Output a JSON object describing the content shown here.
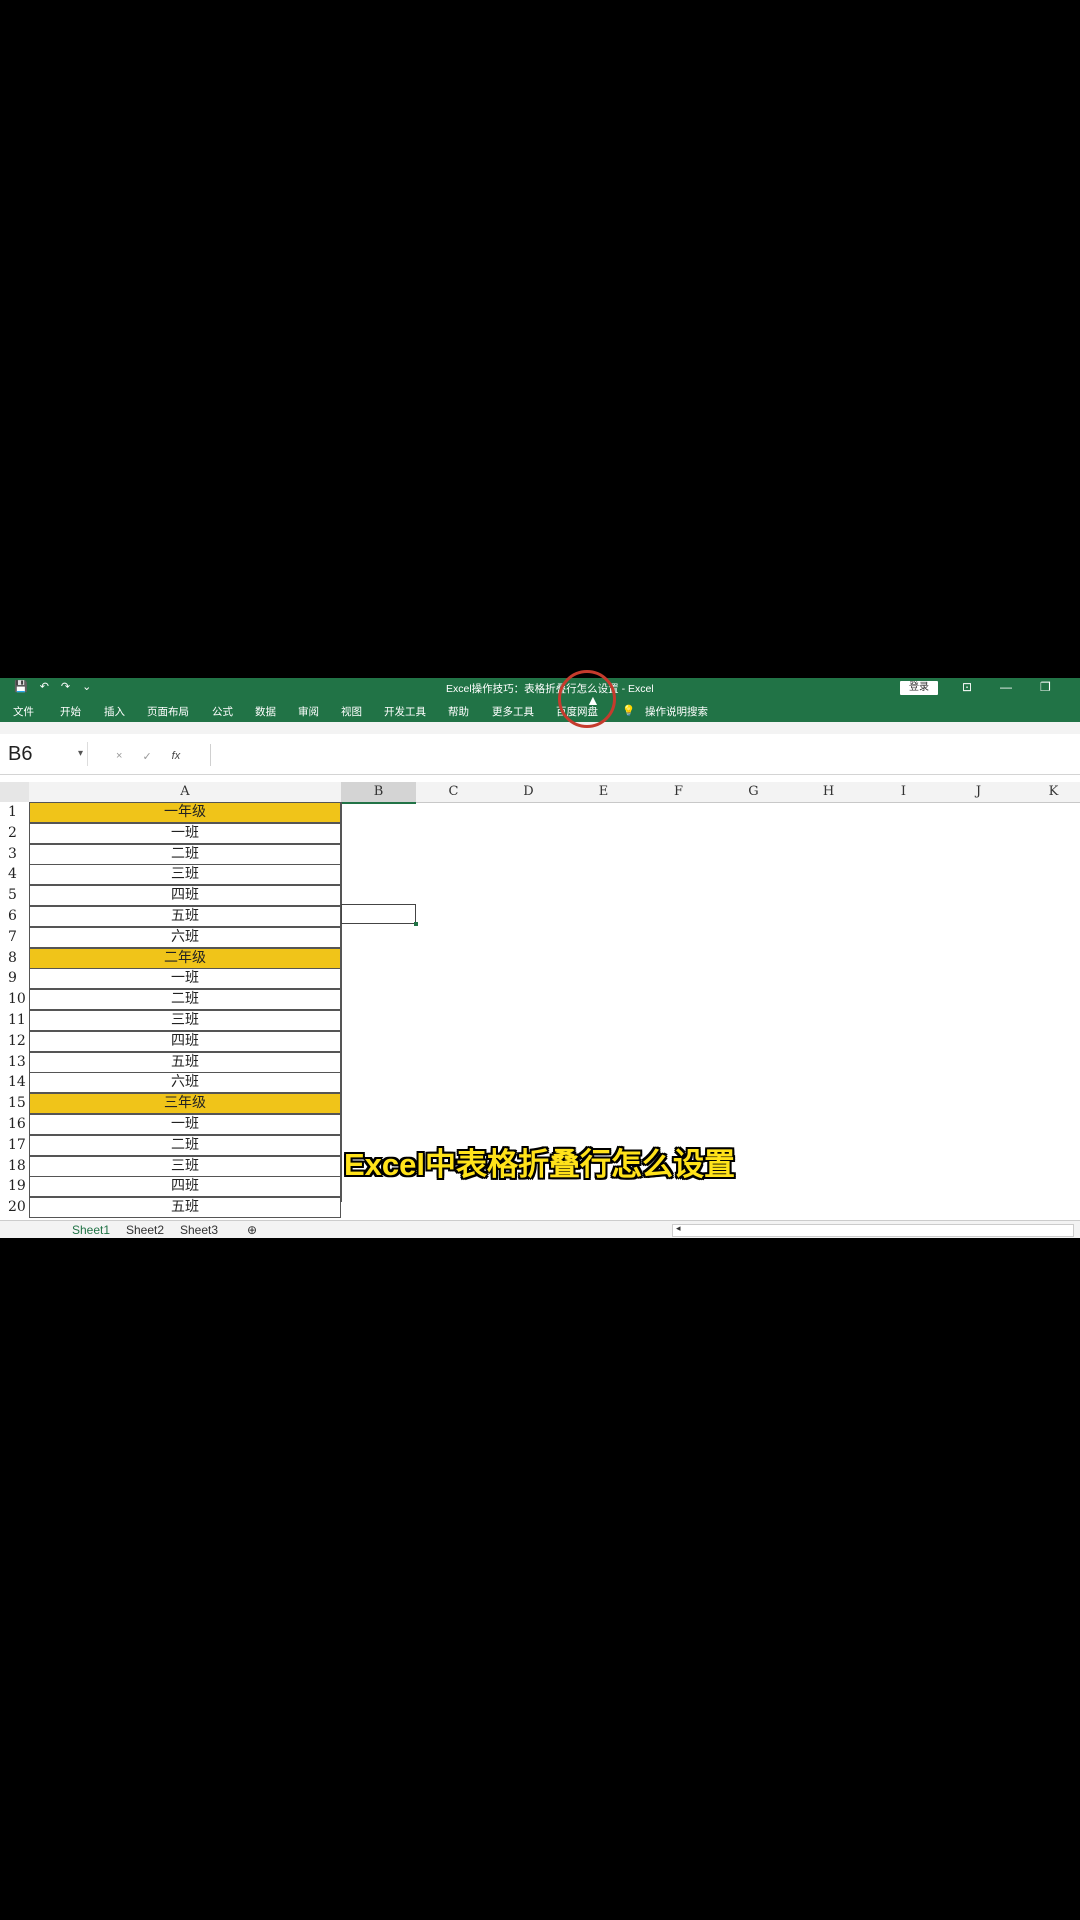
{
  "window": {
    "title": "Excel操作技巧：表格折叠行怎么设置 - Excel",
    "login_label": "登录",
    "qat": {
      "save_icon": "💾",
      "undo_icon": "↶",
      "redo_icon": "↷",
      "more_icon": "⌄"
    },
    "controls": {
      "ribbon_display": "⊡",
      "minimize": "—",
      "restore": "❐"
    }
  },
  "ribbon": {
    "tabs": [
      "文件",
      "开始",
      "插入",
      "页面布局",
      "公式",
      "数据",
      "审阅",
      "视图",
      "开发工具",
      "帮助",
      "更多工具",
      "百度网盘"
    ],
    "tell_me": "操作说明搜索",
    "tell_me_icon": "💡"
  },
  "formula_bar": {
    "name_box": "B6",
    "cancel_icon": "×",
    "confirm_icon": "✓",
    "fx_label": "fx",
    "value": ""
  },
  "grid": {
    "columns": [
      "A",
      "B",
      "C",
      "D",
      "E",
      "F",
      "G",
      "H",
      "I",
      "J",
      "K"
    ],
    "selected_column": "B",
    "selected_cell": "B6",
    "rows": [
      {
        "num": "1",
        "a": "一年级",
        "grade": true
      },
      {
        "num": "2",
        "a": "一班",
        "grade": false
      },
      {
        "num": "3",
        "a": "二班",
        "grade": false
      },
      {
        "num": "4",
        "a": "三班",
        "grade": false
      },
      {
        "num": "5",
        "a": "四班",
        "grade": false
      },
      {
        "num": "6",
        "a": "五班",
        "grade": false
      },
      {
        "num": "7",
        "a": "六班",
        "grade": false
      },
      {
        "num": "8",
        "a": "二年级",
        "grade": true
      },
      {
        "num": "9",
        "a": "一班",
        "grade": false
      },
      {
        "num": "10",
        "a": "二班",
        "grade": false
      },
      {
        "num": "11",
        "a": "三班",
        "grade": false
      },
      {
        "num": "12",
        "a": "四班",
        "grade": false
      },
      {
        "num": "13",
        "a": "五班",
        "grade": false
      },
      {
        "num": "14",
        "a": "六班",
        "grade": false
      },
      {
        "num": "15",
        "a": "三年级",
        "grade": true
      },
      {
        "num": "16",
        "a": "一班",
        "grade": false
      },
      {
        "num": "17",
        "a": "二班",
        "grade": false
      },
      {
        "num": "18",
        "a": "三班",
        "grade": false
      },
      {
        "num": "19",
        "a": "四班",
        "grade": false
      },
      {
        "num": "20",
        "a": "五班",
        "grade": false
      }
    ]
  },
  "sheets": [
    "Sheet1",
    "Sheet2",
    "Sheet3"
  ],
  "active_sheet": "Sheet1",
  "add_sheet_icon": "⊕",
  "scroll_left_icon": "◂",
  "caption": "Excel中表格折叠行怎么设置",
  "colors": {
    "excel_green": "#217346",
    "grade_fill": "#f0c419",
    "caption": "#ffe21a",
    "highlight_circle": "#c53b2d"
  }
}
